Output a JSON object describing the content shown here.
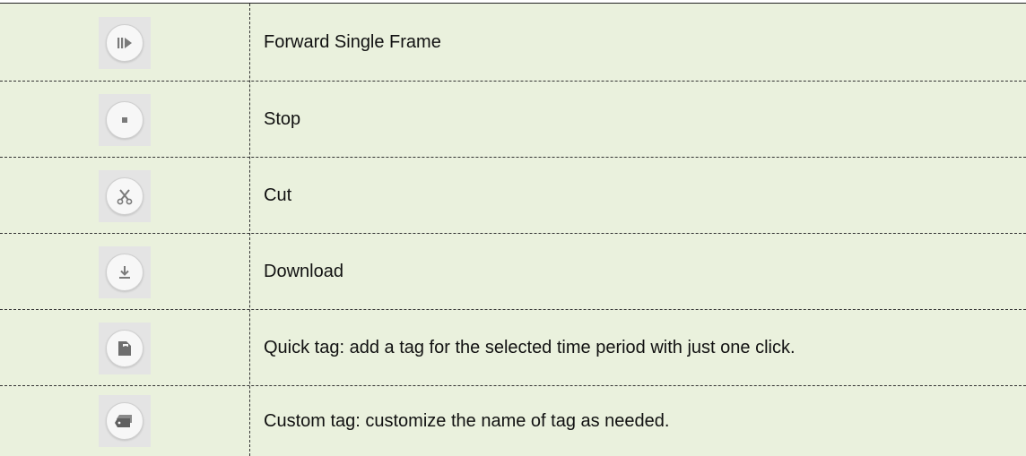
{
  "rows": [
    {
      "icon": "forward-single-frame-icon",
      "description": "Forward Single Frame"
    },
    {
      "icon": "stop-icon",
      "description": "Stop"
    },
    {
      "icon": "cut-icon",
      "description": "Cut"
    },
    {
      "icon": "download-icon",
      "description": "Download"
    },
    {
      "icon": "quick-tag-icon",
      "description": "Quick tag: add a tag for the selected time period with just one click."
    },
    {
      "icon": "custom-tag-icon",
      "description": "Custom tag: customize the name of tag as needed."
    }
  ],
  "colors": {
    "row_background": "#eaf1dd",
    "icon_tile": "#e4e4e4",
    "icon_glyph": "#7a7a7a",
    "rule": "#333333"
  }
}
